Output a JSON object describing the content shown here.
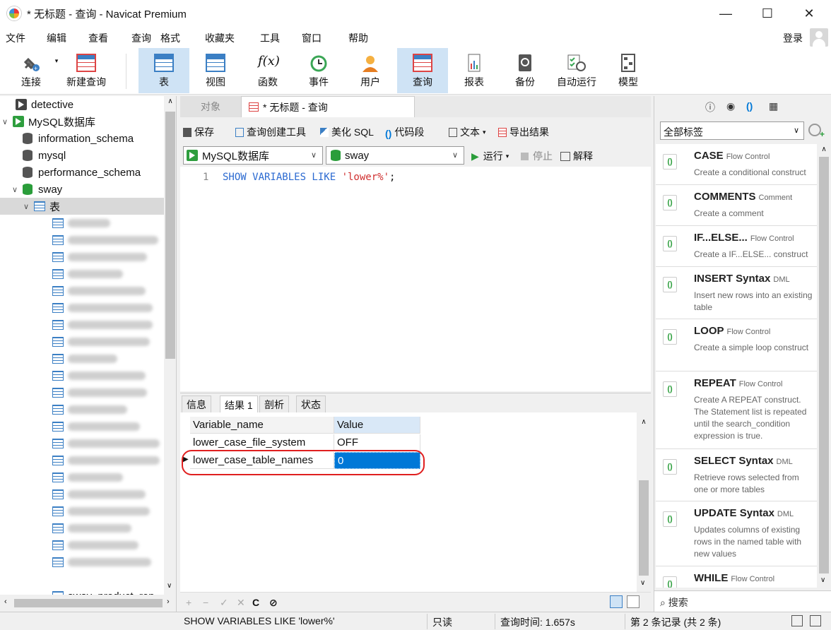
{
  "window": {
    "title": "* 无标题 - 查询 - Navicat Premium",
    "minimize": "—",
    "maximize": "☐",
    "close": "✕"
  },
  "menu": {
    "items": [
      "文件",
      "编辑",
      "查看",
      "查询",
      "格式",
      "收藏夹",
      "工具",
      "窗口",
      "帮助"
    ],
    "login": "登录"
  },
  "toolbar": {
    "buttons": [
      {
        "label": "连接"
      },
      {
        "label": "新建查询"
      },
      {
        "label": "表"
      },
      {
        "label": "视图"
      },
      {
        "label": "函数"
      },
      {
        "label": "事件"
      },
      {
        "label": "用户"
      },
      {
        "label": "查询"
      },
      {
        "label": "报表"
      },
      {
        "label": "备份"
      },
      {
        "label": "自动运行"
      },
      {
        "label": "模型"
      }
    ],
    "function_glyph": "f(x)"
  },
  "tree": {
    "connections": [
      {
        "label": "detective"
      },
      {
        "label": "MySQL数据库"
      }
    ],
    "databases": [
      {
        "label": "information_schema"
      },
      {
        "label": "mysql"
      },
      {
        "label": "performance_schema"
      },
      {
        "label": "sway"
      }
    ],
    "tables_node": "表",
    "partial_item": "sway_product_rep"
  },
  "tabs": [
    {
      "label": "对象"
    },
    {
      "label": "* 无标题 - 查询"
    }
  ],
  "query_toolbar": {
    "save": "保存",
    "builder": "查询创建工具",
    "beautify": "美化 SQL",
    "snippet": "代码段",
    "text": "文本",
    "export": "导出结果"
  },
  "selectors": {
    "connection": "MySQL数据库",
    "database": "sway",
    "run": "运行",
    "stop": "停止",
    "explain": "解释"
  },
  "editor": {
    "line_number": "1",
    "keyword": "SHOW VARIABLES LIKE ",
    "string": "'lower%'",
    "terminator": ";"
  },
  "result_tabs": [
    "信息",
    "结果 1",
    "剖析",
    "状态"
  ],
  "result_grid": {
    "headers": [
      "Variable_name",
      "Value"
    ],
    "rows": [
      [
        "lower_case_file_system",
        "OFF"
      ],
      [
        "lower_case_table_names",
        "0"
      ]
    ]
  },
  "grid_footer": {
    "add": "+",
    "remove": "−",
    "apply": "✓",
    "discard": "✕",
    "refresh": "C",
    "stop": "⊘"
  },
  "right_panel": {
    "tag_filter": "全部标签",
    "search": "搜索",
    "snippets": [
      {
        "name": "CASE",
        "category": "Flow Control",
        "desc": "Create a conditional construct"
      },
      {
        "name": "COMMENTS",
        "category": "Comment",
        "desc": "Create a comment"
      },
      {
        "name": "IF...ELSE...",
        "category": "Flow Control",
        "desc": "Create a IF...ELSE... construct"
      },
      {
        "name": "INSERT Syntax",
        "category": "DML",
        "desc": "Insert new rows into an existing table"
      },
      {
        "name": "LOOP",
        "category": "Flow Control",
        "desc": "Create a simple loop construct"
      },
      {
        "name": "REPEAT",
        "category": "Flow Control",
        "desc": "Create A REPEAT construct. The Statement list is repeated until the search_condition expression is true."
      },
      {
        "name": "SELECT Syntax",
        "category": "DML",
        "desc": "Retrieve rows selected from one or more tables"
      },
      {
        "name": "UPDATE Syntax",
        "category": "DML",
        "desc": "Updates columns of existing rows in the named table with new values"
      },
      {
        "name": "WHILE",
        "category": "Flow Control",
        "desc": ""
      }
    ]
  },
  "status": {
    "sql": "SHOW VARIABLES LIKE 'lower%'",
    "mode": "只读",
    "time": "查询时间: 1.657s",
    "records": "第 2 条记录 (共 2 条)"
  },
  "colors": {
    "accent": "#0078d7",
    "highlight": "#e01f1f",
    "keyword": "#2b6ad1",
    "string": "#d03030"
  }
}
